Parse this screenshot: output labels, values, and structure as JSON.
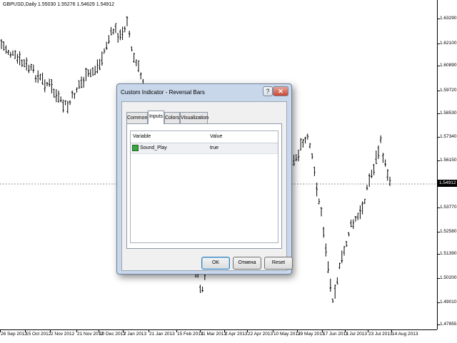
{
  "chart": {
    "title": "GBPUSD,Daily  1.55030 1.55276 1.54629 1.54912",
    "current_price": "1.54912",
    "price_labels": [
      "1.63290",
      "1.62100",
      "1.60890",
      "1.59720",
      "1.58530",
      "1.57340",
      "1.56150",
      "1.54912",
      "1.53770",
      "1.52580",
      "1.51390",
      "1.50200",
      "1.49010",
      "1.47855"
    ],
    "date_labels": [
      "26 Sep 2012",
      "15 Oct 2012",
      "2 Nov 2012",
      "21 Nov 2012",
      "10 Dec 2012",
      "2 Jan 2013",
      "21 Jan 2013",
      "15 Feb 2013",
      "11 Mar 2013",
      "2 Apr 2013",
      "22 Apr 2013",
      "10 May 2013",
      "29 May 2013",
      "17 Jun 2013",
      "1 Jul 2013",
      "23 Jul 2013",
      "14 Aug 2013"
    ]
  },
  "dialog": {
    "title": "Custom Indicator - Reversal Bars",
    "help_glyph": "?",
    "close_glyph": "✕",
    "tabs": [
      {
        "label": "Common"
      },
      {
        "label": "Inputs"
      },
      {
        "label": "Colors"
      },
      {
        "label": "Visualization"
      }
    ],
    "table": {
      "col_variable": "Variable",
      "col_value": "Value",
      "rows": [
        {
          "variable": "Sound_Play",
          "value": "true"
        }
      ]
    },
    "buttons": {
      "ok": "OK",
      "cancel": "Отмена",
      "reset": "Reset"
    }
  }
}
